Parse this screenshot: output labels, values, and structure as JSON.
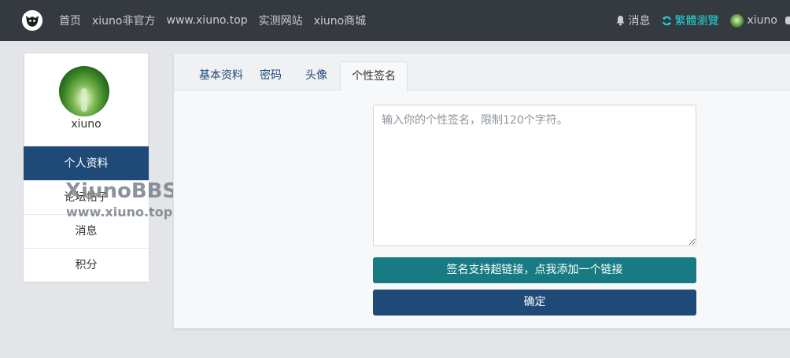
{
  "topnav": {
    "links": [
      "首页",
      "xiuno非官方",
      "www.xiuno.top",
      "实测网站",
      "xiuno商城"
    ],
    "messages_label": "消息",
    "traditional_label": "繁體瀏覽",
    "username": "xiuno",
    "accent_color": "#22d3d3"
  },
  "sidebar": {
    "username": "xiuno",
    "items": [
      {
        "label": "个人资料",
        "active": true
      },
      {
        "label": "论坛帖子",
        "active": false
      },
      {
        "label": "消息",
        "active": false
      },
      {
        "label": "积分",
        "active": false
      }
    ],
    "active_color": "#1f4a78"
  },
  "watermark": {
    "line1": "XiunoBBS",
    "line2": "www.xiuno.top"
  },
  "main": {
    "tabs": [
      {
        "label": "基本资料",
        "active": false
      },
      {
        "label": "密码",
        "active": false
      },
      {
        "label": "头像",
        "active": false
      },
      {
        "label": "个性签名",
        "active": true
      }
    ],
    "signature_placeholder": "输入你的个性签名，限制120个字符。",
    "signature_value": "",
    "add_link_label": "签名支持超链接，点我添加一个链接",
    "confirm_label": "确定",
    "colors": {
      "link_button": "#187b83",
      "confirm_button": "#1f4a78"
    }
  }
}
